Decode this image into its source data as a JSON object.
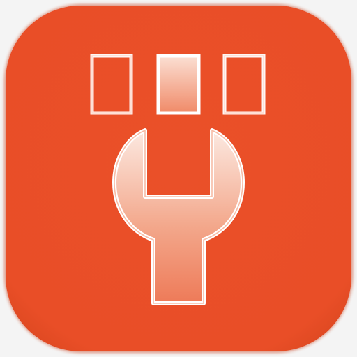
{
  "app_icon": {
    "icon_name": "wrench-with-indicator-lights-icon",
    "colors": {
      "page_background": "#f4f4f4",
      "tile_background": "#e94e27",
      "tile_edge_shadow": "#c84320",
      "glyph_outline": "#ffffff",
      "glyph_fill_light": "#fbe7df",
      "glyph_fill_dark": "#ee7a58"
    },
    "indicator_blocks": [
      {
        "name": "left",
        "state": "outline"
      },
      {
        "name": "middle",
        "state": "filled"
      },
      {
        "name": "right",
        "state": "outline"
      }
    ]
  }
}
